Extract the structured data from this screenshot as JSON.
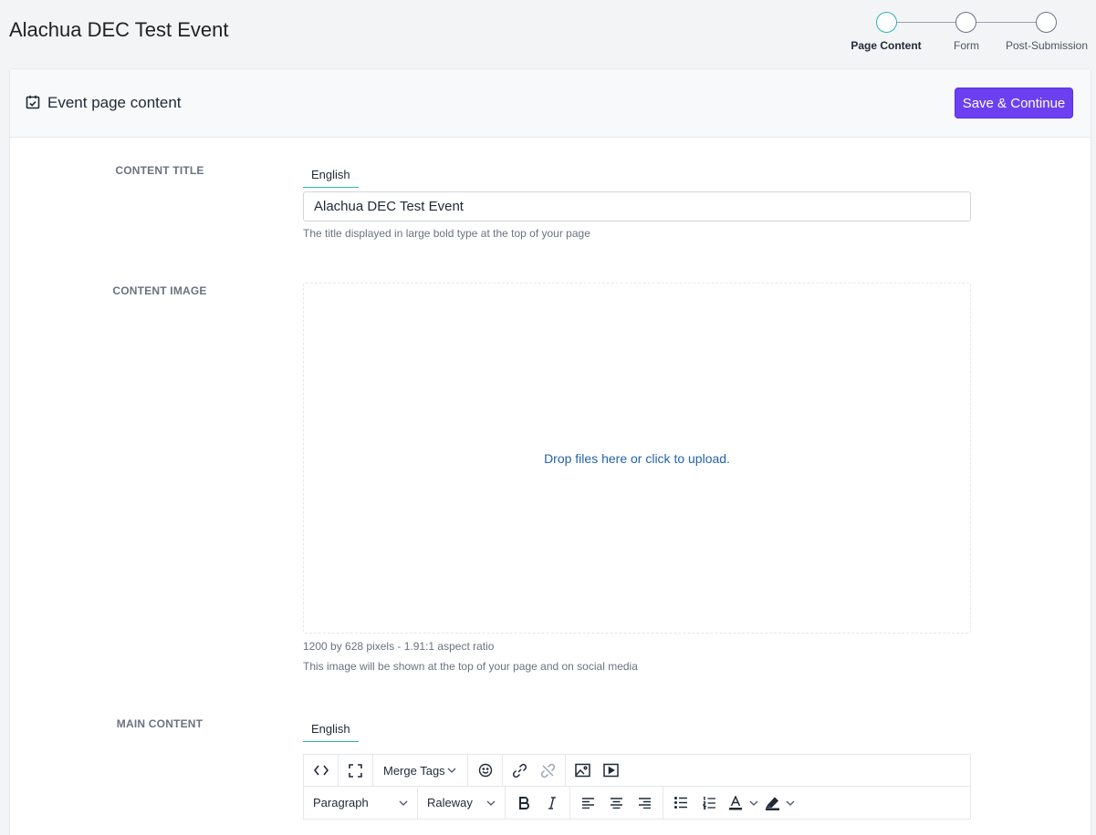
{
  "page": {
    "title": "Alachua DEC Test Event"
  },
  "stepper": {
    "steps": [
      {
        "label": "Page Content",
        "active": true
      },
      {
        "label": "Form",
        "active": false
      },
      {
        "label": "Post-Submission",
        "active": false
      }
    ],
    "active_color": "#2bb5b0"
  },
  "card": {
    "title": "Event page content",
    "icon": "calendar-check-icon",
    "save_label": "Save & Continue",
    "accent_color": "#6c3ff0"
  },
  "content_title": {
    "label": "CONTENT TITLE",
    "tab": "English",
    "value": "Alachua DEC Test Event",
    "help": "The title displayed in large bold type at the top of your page"
  },
  "content_image": {
    "label": "CONTENT IMAGE",
    "dropzone_text": "Drop files here or click to upload.",
    "help_size": "1200 by 628 pixels - 1.91:1 aspect ratio",
    "help_usage": "This image will be shown at the top of your page and on social media"
  },
  "main_content": {
    "label": "MAIN CONTENT",
    "tab": "English",
    "toolbar": {
      "merge_tags": "Merge Tags",
      "block_format": "Paragraph",
      "font_family": "Raleway"
    }
  }
}
